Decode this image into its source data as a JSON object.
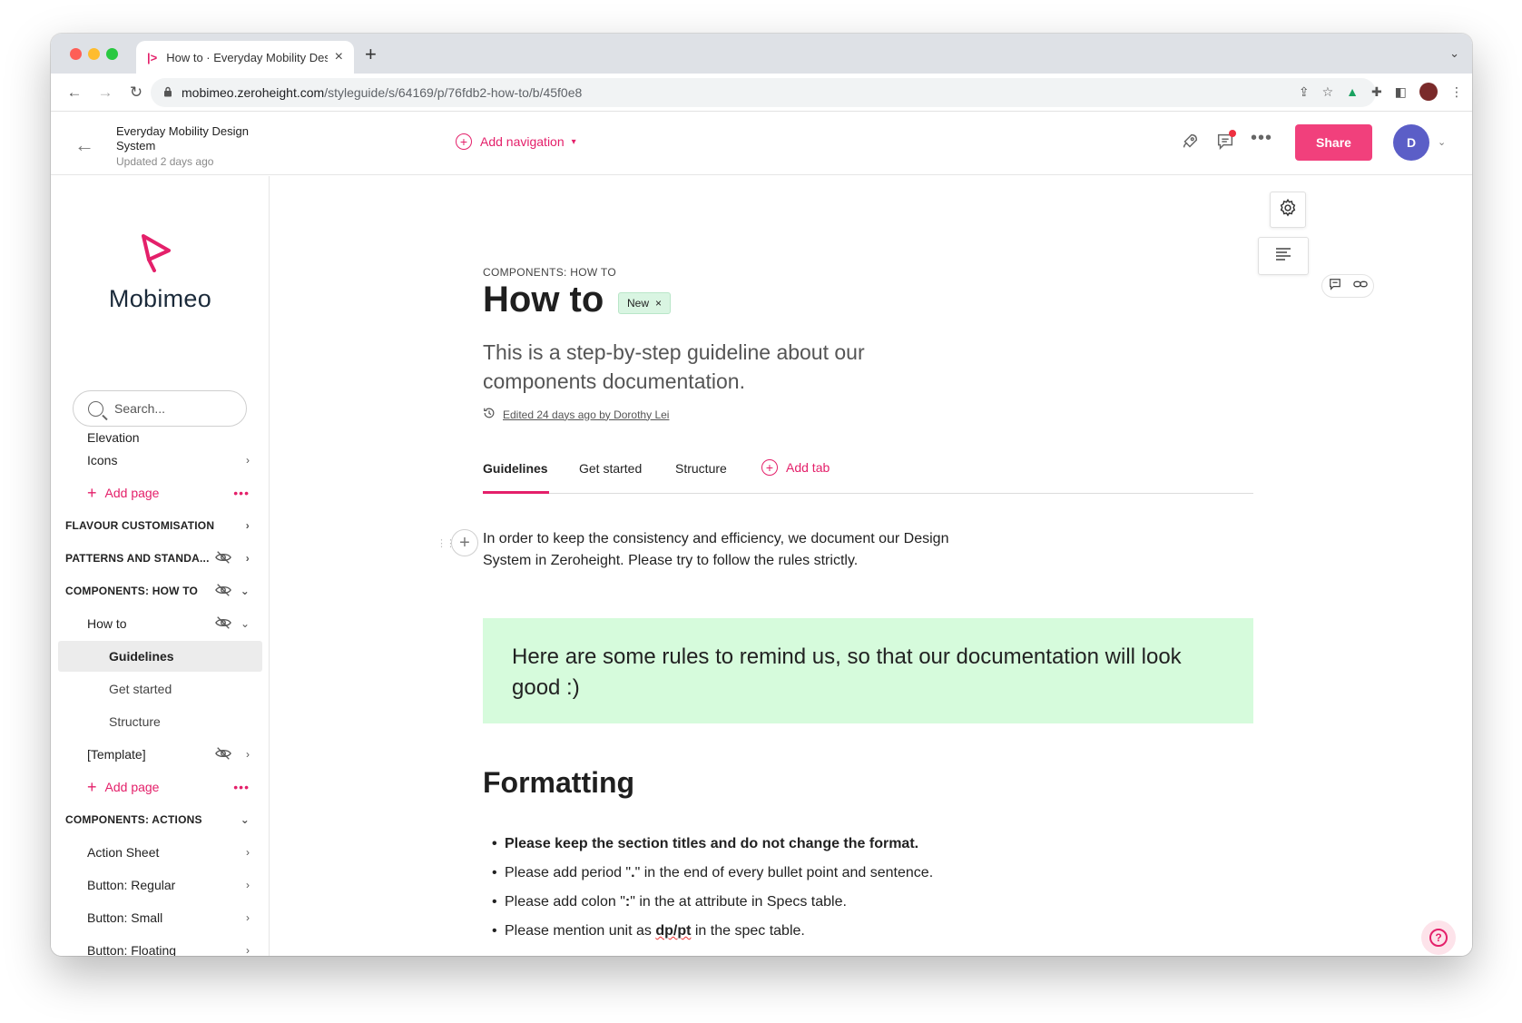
{
  "browser": {
    "tab_title": "How to · Everyday Mobility Des",
    "url_host": "mobimeo.zeroheight.com",
    "url_path": "/styleguide/s/64169/p/76fdb2-how-to/b/45f0e8"
  },
  "header": {
    "project_name": "Everyday Mobility Design System",
    "updated": "Updated 2 days ago",
    "add_navigation": "Add navigation",
    "share_label": "Share",
    "avatar_initial": "D"
  },
  "sidebar": {
    "logo_text": "Mobimeo",
    "search_placeholder": "Search...",
    "items": [
      {
        "label": "Elevation"
      },
      {
        "label": "Icons"
      },
      {
        "label": "Add page"
      },
      {
        "label": "FLAVOUR CUSTOMISATION"
      },
      {
        "label": "PATTERNS AND STANDA..."
      },
      {
        "label": "COMPONENTS: HOW TO"
      },
      {
        "label": "How to"
      },
      {
        "label": "Guidelines"
      },
      {
        "label": "Get started"
      },
      {
        "label": "Structure"
      },
      {
        "label": "[Template]"
      },
      {
        "label": "Add page"
      },
      {
        "label": "COMPONENTS: ACTIONS"
      },
      {
        "label": "Action Sheet"
      },
      {
        "label": "Button: Regular"
      },
      {
        "label": "Button: Small"
      },
      {
        "label": "Button: Floating"
      }
    ]
  },
  "page": {
    "category": "COMPONENTS: HOW TO",
    "title": "How to",
    "badge": "New",
    "subtitle": "This is a step-by-step guideline about our components documentation.",
    "edited": "Edited 24 days ago by Dorothy Lei",
    "tabs": [
      {
        "label": "Guidelines"
      },
      {
        "label": "Get started"
      },
      {
        "label": "Structure"
      }
    ],
    "add_tab": "Add tab",
    "intro": "In order to keep the consistency and efficiency, we document our Design System in Zeroheight. Please try to follow the rules strictly.",
    "callout": "Here are some rules to remind us, so that our documentation will look good :)",
    "section_heading": "Formatting",
    "bullets": {
      "b1": "Please keep the section titles and do not change the format.",
      "b2_pre": "Please add period \"",
      "b2_mark": ".",
      "b2_post": "\" in the end of every bullet point and sentence.",
      "b3_pre": "Please add colon \"",
      "b3_mark": ":",
      "b3_post": "\" in the at attribute in Specs table.",
      "b4_pre": "Please mention unit as ",
      "b4_mark": "dp/pt",
      "b4_post": " in the spec table."
    }
  },
  "colors": {
    "accent": "#e4206a",
    "share_bg": "#f1407c",
    "callout_bg": "#d6fbdc",
    "badge_bg": "#d9f5e2",
    "avatar_bg": "#5b5ec7"
  }
}
